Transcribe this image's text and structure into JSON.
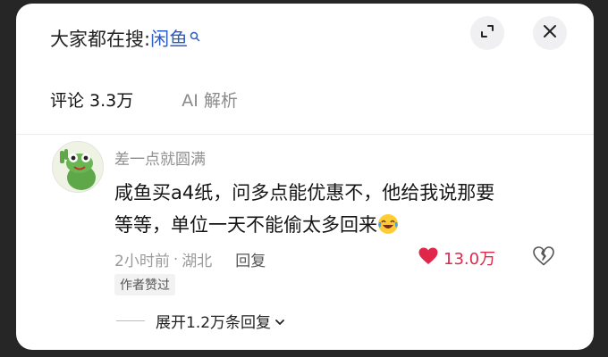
{
  "header": {
    "prefix": "大家都在搜:",
    "keyword": "闲鱼",
    "icons": {
      "search": "search-icon",
      "expand": "expand-icon",
      "close": "close-icon"
    }
  },
  "tabs": [
    {
      "label": "评论 3.3万",
      "active": true
    },
    {
      "label": "AI 解析",
      "active": false
    }
  ],
  "comment": {
    "username": "差一点就圆满",
    "text_line1": "咸鱼买a4纸，问多点能优惠不，他给我说那要",
    "text_line2": "等等，单位一天不能偷太多回来",
    "emoji": "laughing-crying-emoji",
    "time": "2小时前",
    "separator": "·",
    "location": "湖北",
    "reply_label": "回复",
    "like_count": "13.0万",
    "liked": true,
    "author_badge": "作者赞过",
    "expand_replies": "展开1.2万条回复"
  },
  "colors": {
    "keyword": "#2c5cc5",
    "like": "#e0264a",
    "text": "#151515",
    "muted": "#9a9a9a"
  }
}
